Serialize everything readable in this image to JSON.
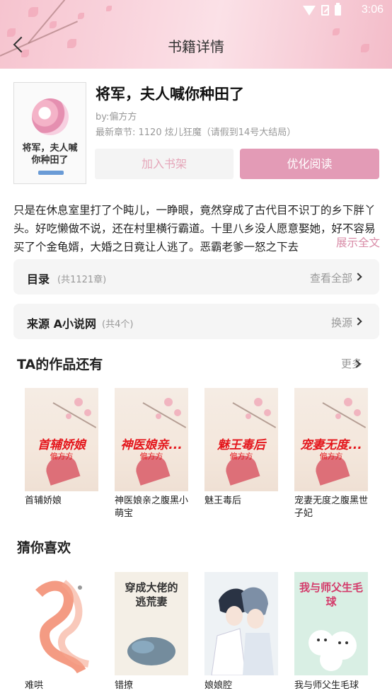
{
  "status_bar": {
    "time": "3:06"
  },
  "header": {
    "title": "书籍详情"
  },
  "book": {
    "title": "将军，夫人喊你种田了",
    "cover_title": "将军，夫人喊你种田了",
    "author": "by:偏方方",
    "latest": "最新章节: 1120 炫儿狂魔（请假到14号大结局）",
    "btn_shelf": "加入书架",
    "btn_read": "优化阅读",
    "intro": "只是在休息室里打了个盹儿，一睁眼，竟然穿成了古代目不识丁的乡下胖丫头。好吃懒做不说，还在村里横行霸道。十里八乡没人愿意娶她，好不容易买了个金龟婿，大婚之日竟让人逃了。恶霸老爹一怒之下去",
    "intro_more": "展示全文"
  },
  "catalog": {
    "label": "目录",
    "count": "(共1121章)",
    "right": "查看全部"
  },
  "source": {
    "label": "来源 A小说网",
    "count": "(共4个)",
    "right": "换源"
  },
  "works_section": {
    "title": "TA的作品还有",
    "more": "更多",
    "items": [
      {
        "cover_title": "首辅娇娘",
        "cover_author": "偏方方",
        "name": "首辅娇娘"
      },
      {
        "cover_title": "神医娘亲...",
        "cover_author": "偏方方",
        "name": "神医娘亲之腹黑小萌宝"
      },
      {
        "cover_title": "魅王毒后",
        "cover_author": "偏方方",
        "name": "魅王毒后"
      },
      {
        "cover_title": "宠妻无度...",
        "cover_author": "偏方方",
        "name": "宠妻无度之腹黑世子妃"
      }
    ]
  },
  "guess_section": {
    "title": "猜你喜欢",
    "items": [
      {
        "name": "难哄"
      },
      {
        "name": "错撩",
        "cover_text": "穿成大佬的逃荒妻"
      },
      {
        "name": "娘娘腔"
      },
      {
        "name": "我与师父生毛球",
        "cover_text": "我与师父生毛球"
      }
    ]
  }
}
